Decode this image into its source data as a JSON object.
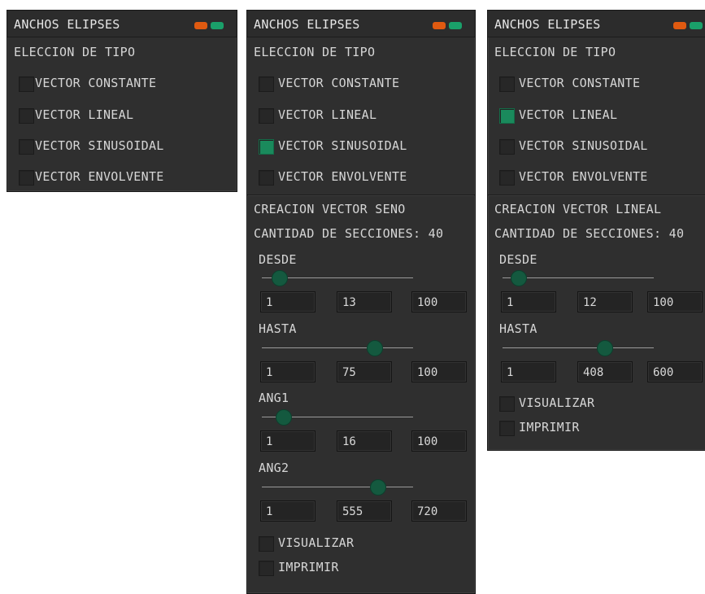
{
  "colors": {
    "panel_bg": "#2f2f2f",
    "check_on": "#1a8a5c",
    "knob": "#14593f",
    "btn_orange": "#e05a10",
    "btn_green": "#1aa06a"
  },
  "panel1": {
    "title": "ANCHOS ELIPSES",
    "section": "ELECCION DE TIPO",
    "options": [
      {
        "label": "VECTOR CONSTANTE",
        "checked": false
      },
      {
        "label": "VECTOR LINEAL",
        "checked": false
      },
      {
        "label": "VECTOR SINUSOIDAL",
        "checked": false
      },
      {
        "label": "VECTOR ENVOLVENTE",
        "checked": false
      }
    ]
  },
  "panel2": {
    "title": "ANCHOS ELIPSES",
    "section": "ELECCION DE TIPO",
    "options": [
      {
        "label": "VECTOR CONSTANTE",
        "checked": false
      },
      {
        "label": "VECTOR LINEAL",
        "checked": false
      },
      {
        "label": "VECTOR SINUSOIDAL",
        "checked": true
      },
      {
        "label": "VECTOR ENVOLVENTE",
        "checked": false
      }
    ],
    "creation_title": "CREACION VECTOR SENO",
    "sections_label": "CANTIDAD DE SECCIONES: 40",
    "sliders": [
      {
        "label": "DESDE",
        "min": "1",
        "value": "13",
        "max": "100"
      },
      {
        "label": "HASTA",
        "min": "1",
        "value": "75",
        "max": "100"
      },
      {
        "label": "ANG1",
        "min": "1",
        "value": "16",
        "max": "100"
      },
      {
        "label": "ANG2",
        "min": "1",
        "value": "555",
        "max": "720"
      }
    ],
    "visualize": "VISUALIZAR",
    "print": "IMPRIMIR"
  },
  "panel3": {
    "title": "ANCHOS ELIPSES",
    "section": "ELECCION DE TIPO",
    "options": [
      {
        "label": "VECTOR CONSTANTE",
        "checked": false
      },
      {
        "label": "VECTOR LINEAL",
        "checked": true
      },
      {
        "label": "VECTOR SINUSOIDAL",
        "checked": false
      },
      {
        "label": "VECTOR ENVOLVENTE",
        "checked": false
      }
    ],
    "creation_title": "CREACION VECTOR LINEAL",
    "sections_label": "CANTIDAD DE SECCIONES: 40",
    "sliders": [
      {
        "label": "DESDE",
        "min": "1",
        "value": "12",
        "max": "100"
      },
      {
        "label": "HASTA",
        "min": "1",
        "value": "408",
        "max": "600"
      }
    ],
    "visualize": "VISUALIZAR",
    "print": "IMPRIMIR"
  }
}
